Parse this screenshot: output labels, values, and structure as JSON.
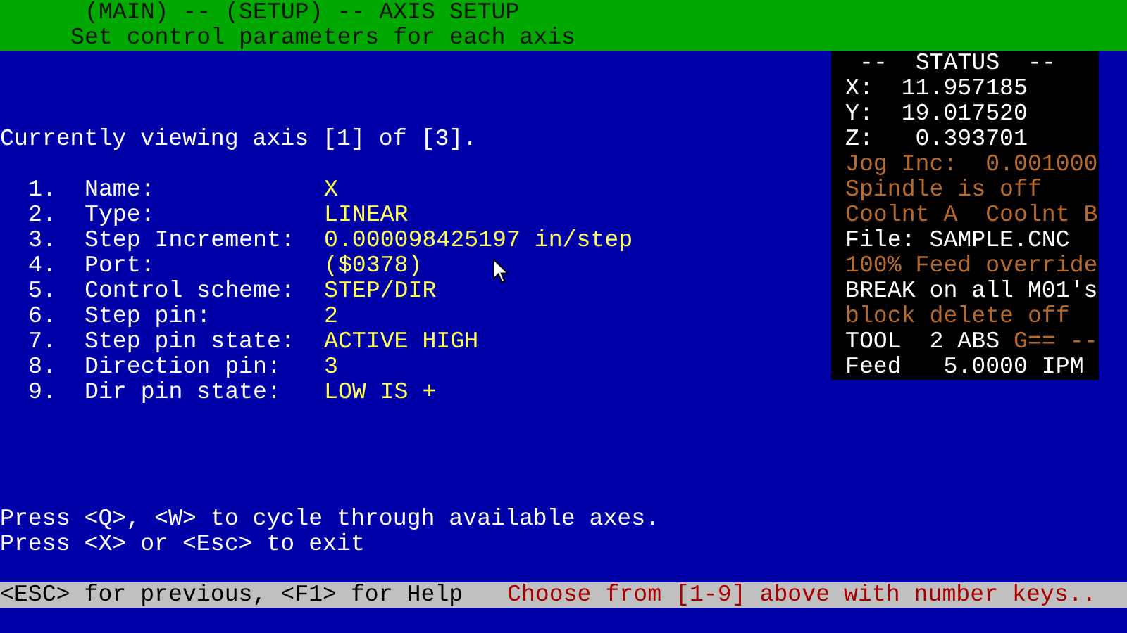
{
  "header": {
    "title": "(MAIN) -- (SETUP) -- AXIS SETUP",
    "subtitle": "Set control parameters for each axis"
  },
  "viewing": "Currently viewing axis [1] of [3].",
  "items": [
    {
      "number": "1.",
      "label": "Name:",
      "value": "X"
    },
    {
      "number": "2.",
      "label": "Type:",
      "value": "LINEAR"
    },
    {
      "number": "3.",
      "label": "Step Increment:",
      "value": "0.000098425197 in/step"
    },
    {
      "number": "4.",
      "label": "Port:",
      "value": "($0378)"
    },
    {
      "number": "5.",
      "label": "Control scheme:",
      "value": "STEP/DIR"
    },
    {
      "number": "6.",
      "label": "Step pin:",
      "value": "2"
    },
    {
      "number": "7.",
      "label": "Step pin state:",
      "value": "ACTIVE HIGH"
    },
    {
      "number": "8.",
      "label": "Direction pin:",
      "value": "3"
    },
    {
      "number": "9.",
      "label": "Dir pin state:",
      "value": "LOW IS +"
    }
  ],
  "instructions": [
    "Press <Q>, <W> to cycle through available axes.",
    "Press <X> or <Esc> to exit"
  ],
  "status": {
    "lines": [
      {
        "segments": [
          {
            "text": "--  STATUS  --",
            "kind": "bright"
          }
        ]
      },
      {
        "segments": [
          {
            "text": "X:  11.957185",
            "kind": "bright"
          }
        ]
      },
      {
        "segments": [
          {
            "text": "Y:  19.017520",
            "kind": "bright"
          }
        ]
      },
      {
        "segments": [
          {
            "text": "Z:   0.393701",
            "kind": "bright"
          }
        ]
      },
      {
        "segments": [
          {
            "text": "Jog Inc:  0.001000",
            "kind": "dim"
          }
        ]
      },
      {
        "segments": [
          {
            "text": "Spindle is off",
            "kind": "dim"
          }
        ]
      },
      {
        "segments": [
          {
            "text": "Coolnt A  Coolnt B",
            "kind": "dim"
          }
        ]
      },
      {
        "segments": [
          {
            "text": "File: SAMPLE.CNC",
            "kind": "bright"
          }
        ]
      },
      {
        "segments": [
          {
            "text": "100% Feed override",
            "kind": "dim"
          }
        ]
      },
      {
        "segments": [
          {
            "text": "BREAK on all M01's",
            "kind": "bright"
          }
        ]
      },
      {
        "segments": [
          {
            "text": "block delete off",
            "kind": "dim"
          }
        ]
      },
      {
        "segments": [
          {
            "text": "TOOL  2 ABS",
            "kind": "bright"
          },
          {
            "text": "G== --",
            "kind": "dim"
          }
        ]
      },
      {
        "segments": [
          {
            "text": "Feed   5.0000 IPM",
            "kind": "bright"
          }
        ]
      }
    ]
  },
  "bottom_bar": {
    "help": "<ESC> for previous, <F1> for Help",
    "prompt": "Choose from [1-9] above with number keys.."
  }
}
